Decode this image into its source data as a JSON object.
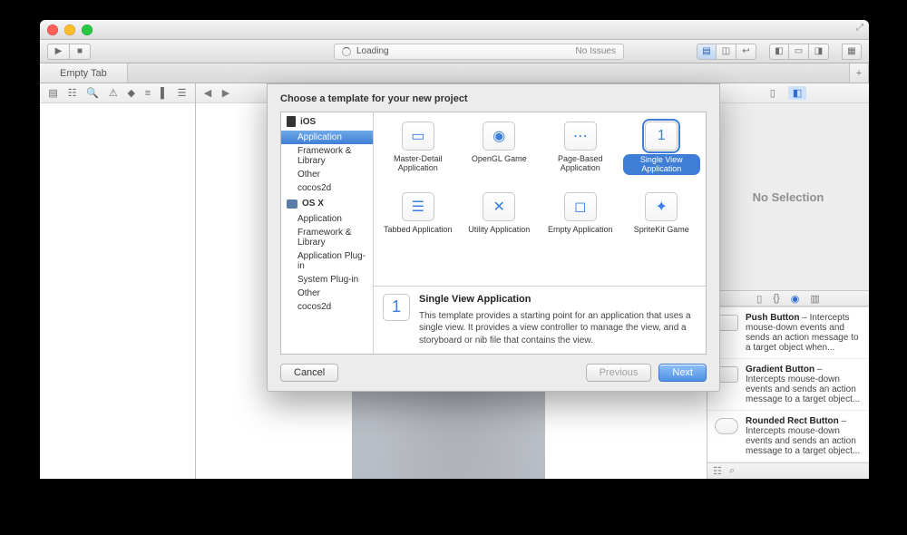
{
  "toolbar": {
    "status_left": "Loading",
    "status_right": "No Issues"
  },
  "tab": {
    "label": "Empty Tab"
  },
  "inspector": {
    "no_selection": "No Selection",
    "library": [
      {
        "title": "Push Button",
        "desc": "Intercepts mouse-down events and sends an action message to a target object when..."
      },
      {
        "title": "Gradient Button",
        "desc": "Intercepts mouse-down events and sends an action message to a target object..."
      },
      {
        "title": "Rounded Rect Button",
        "desc": "Intercepts mouse-down events and sends an action message to a target object..."
      }
    ]
  },
  "sheet": {
    "title": "Choose a template for your new project",
    "platforms": {
      "ios": {
        "label": "iOS",
        "categories": [
          "Application",
          "Framework & Library",
          "Other",
          "cocos2d"
        ]
      },
      "osx": {
        "label": "OS X",
        "categories": [
          "Application",
          "Framework & Library",
          "Application Plug-in",
          "System Plug-in",
          "Other",
          "cocos2d"
        ]
      }
    },
    "selected_category": "Application",
    "templates": [
      {
        "name": "Master-Detail Application",
        "glyph": "▭"
      },
      {
        "name": "OpenGL Game",
        "glyph": "◉"
      },
      {
        "name": "Page-Based Application",
        "glyph": "⋯"
      },
      {
        "name": "Single View Application",
        "glyph": "1"
      },
      {
        "name": "Tabbed Application",
        "glyph": "☰"
      },
      {
        "name": "Utility Application",
        "glyph": "✕"
      },
      {
        "name": "Empty Application",
        "glyph": "◻"
      },
      {
        "name": "SpriteKit Game",
        "glyph": "✦"
      }
    ],
    "selected_template": "Single View Application",
    "detail": {
      "title": "Single View Application",
      "desc": "This template provides a starting point for an application that uses a single view. It provides a view controller to manage the view, and a storyboard or nib file that contains the view.",
      "glyph": "1"
    },
    "buttons": {
      "cancel": "Cancel",
      "previous": "Previous",
      "next": "Next"
    }
  }
}
